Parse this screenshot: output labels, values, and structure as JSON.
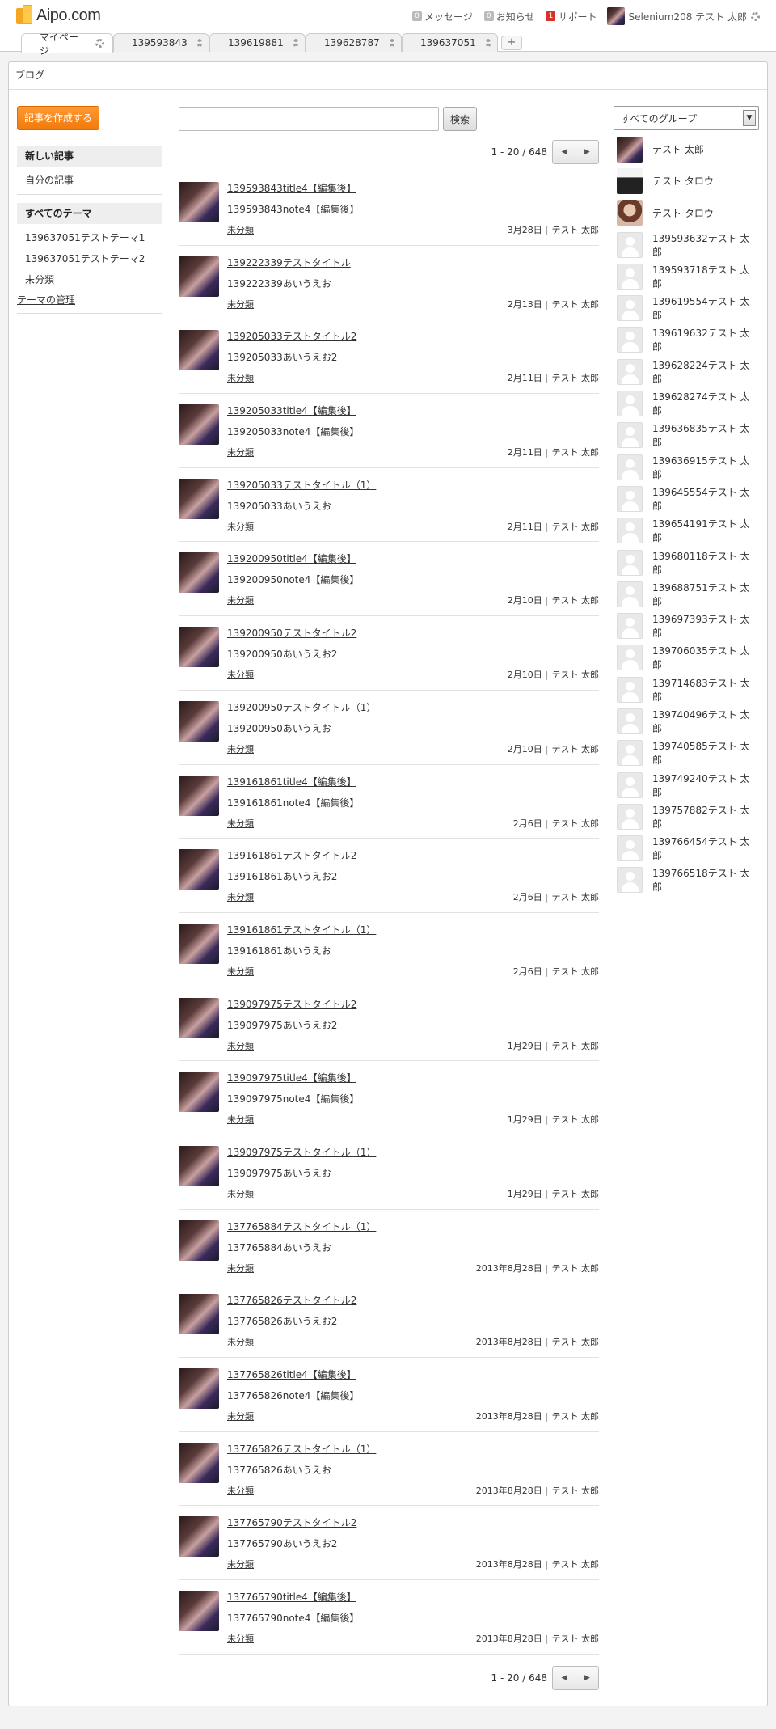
{
  "app": {
    "logo_text": "Aipo.com"
  },
  "header": {
    "messages": {
      "count": "0",
      "label": "メッセージ"
    },
    "notices": {
      "count": "0",
      "label": "お知らせ"
    },
    "support": {
      "count": "1",
      "label": "サポート"
    },
    "user_name": "Selenium208 テスト 太郎"
  },
  "tabs": [
    {
      "label": "マイページ"
    },
    {
      "label": "139593843"
    },
    {
      "label": "139619881"
    },
    {
      "label": "139628787"
    },
    {
      "label": "139637051"
    }
  ],
  "tab_add_label": "+",
  "panel": {
    "title": "ブログ"
  },
  "sidebar": {
    "create_button": "記事を作成する",
    "new_posts": "新しい記事",
    "my_posts": "自分の記事",
    "all_themes": "すべてのテーマ",
    "themes": [
      "139637051テストテーマ1",
      "139637051テストテーマ2",
      "未分類"
    ],
    "manage_themes": "テーマの管理"
  },
  "search": {
    "placeholder": "",
    "value": "",
    "button": "検索"
  },
  "pager": {
    "text": "1 - 20 / 648",
    "prev": "◀",
    "next": "▶"
  },
  "posts": [
    {
      "title": "139593843title4【編集後】",
      "note": "139593843note4【編集後】",
      "theme": "未分類",
      "date": "3月28日",
      "author": "テスト 太郎"
    },
    {
      "title": "139222339テストタイトル",
      "note": "139222339あいうえお",
      "theme": "未分類",
      "date": "2月13日",
      "author": "テスト 太郎"
    },
    {
      "title": "139205033テストタイトル2",
      "note": "139205033あいうえお2",
      "theme": "未分類",
      "date": "2月11日",
      "author": "テスト 太郎"
    },
    {
      "title": "139205033title4【編集後】",
      "note": "139205033note4【編集後】",
      "theme": "未分類",
      "date": "2月11日",
      "author": "テスト 太郎"
    },
    {
      "title": "139205033テストタイトル（1）",
      "note": "139205033あいうえお",
      "theme": "未分類",
      "date": "2月11日",
      "author": "テスト 太郎"
    },
    {
      "title": "139200950title4【編集後】",
      "note": "139200950note4【編集後】",
      "theme": "未分類",
      "date": "2月10日",
      "author": "テスト 太郎"
    },
    {
      "title": "139200950テストタイトル2",
      "note": "139200950あいうえお2",
      "theme": "未分類",
      "date": "2月10日",
      "author": "テスト 太郎"
    },
    {
      "title": "139200950テストタイトル（1）",
      "note": "139200950あいうえお",
      "theme": "未分類",
      "date": "2月10日",
      "author": "テスト 太郎"
    },
    {
      "title": "139161861title4【編集後】",
      "note": "139161861note4【編集後】",
      "theme": "未分類",
      "date": "2月6日",
      "author": "テスト 太郎"
    },
    {
      "title": "139161861テストタイトル2",
      "note": "139161861あいうえお2",
      "theme": "未分類",
      "date": "2月6日",
      "author": "テスト 太郎"
    },
    {
      "title": "139161861テストタイトル（1）",
      "note": "139161861あいうえお",
      "theme": "未分類",
      "date": "2月6日",
      "author": "テスト 太郎"
    },
    {
      "title": "139097975テストタイトル2",
      "note": "139097975あいうえお2",
      "theme": "未分類",
      "date": "1月29日",
      "author": "テスト 太郎"
    },
    {
      "title": "139097975title4【編集後】",
      "note": "139097975note4【編集後】",
      "theme": "未分類",
      "date": "1月29日",
      "author": "テスト 太郎"
    },
    {
      "title": "139097975テストタイトル（1）",
      "note": "139097975あいうえお",
      "theme": "未分類",
      "date": "1月29日",
      "author": "テスト 太郎"
    },
    {
      "title": "137765884テストタイトル（1）",
      "note": "137765884あいうえお",
      "theme": "未分類",
      "date": "2013年8月28日",
      "author": "テスト 太郎"
    },
    {
      "title": "137765826テストタイトル2",
      "note": "137765826あいうえお2",
      "theme": "未分類",
      "date": "2013年8月28日",
      "author": "テスト 太郎"
    },
    {
      "title": "137765826title4【編集後】",
      "note": "137765826note4【編集後】",
      "theme": "未分類",
      "date": "2013年8月28日",
      "author": "テスト 太郎"
    },
    {
      "title": "137765826テストタイトル（1）",
      "note": "137765826あいうえお",
      "theme": "未分類",
      "date": "2013年8月28日",
      "author": "テスト 太郎"
    },
    {
      "title": "137765790テストタイトル2",
      "note": "137765790あいうえお2",
      "theme": "未分類",
      "date": "2013年8月28日",
      "author": "テスト 太郎"
    },
    {
      "title": "137765790title4【編集後】",
      "note": "137765790note4【編集後】",
      "theme": "未分類",
      "date": "2013年8月28日",
      "author": "テスト 太郎"
    }
  ],
  "group_select": {
    "selected": "すべてのグループ",
    "arrow": "▼"
  },
  "members": [
    {
      "name": "テスト 太郎",
      "icon": "photo"
    },
    {
      "name": "テスト タロウ",
      "icon": "suit"
    },
    {
      "name": "テスト タロウ",
      "icon": "girl"
    },
    {
      "name": "139593632テスト 太郎",
      "icon": "blank"
    },
    {
      "name": "139593718テスト 太郎",
      "icon": "blank"
    },
    {
      "name": "139619554テスト 太郎",
      "icon": "blank"
    },
    {
      "name": "139619632テスト 太郎",
      "icon": "blank"
    },
    {
      "name": "139628224テスト 太郎",
      "icon": "blank"
    },
    {
      "name": "139628274テスト 太郎",
      "icon": "blank"
    },
    {
      "name": "139636835テスト 太郎",
      "icon": "blank"
    },
    {
      "name": "139636915テスト 太郎",
      "icon": "blank"
    },
    {
      "name": "139645554テスト 太郎",
      "icon": "blank"
    },
    {
      "name": "139654191テスト 太郎",
      "icon": "blank"
    },
    {
      "name": "139680118テスト 太郎",
      "icon": "blank"
    },
    {
      "name": "139688751テスト 太郎",
      "icon": "blank"
    },
    {
      "name": "139697393テスト 太郎",
      "icon": "blank"
    },
    {
      "name": "139706035テスト 太郎",
      "icon": "blank"
    },
    {
      "name": "139714683テスト 太郎",
      "icon": "blank"
    },
    {
      "name": "139740496テスト 太郎",
      "icon": "blank"
    },
    {
      "name": "139740585テスト 太郎",
      "icon": "blank"
    },
    {
      "name": "139749240テスト 太郎",
      "icon": "blank"
    },
    {
      "name": "139757882テスト 太郎",
      "icon": "blank"
    },
    {
      "name": "139766454テスト 太郎",
      "icon": "blank"
    },
    {
      "name": "139766518テスト 太郎",
      "icon": "blank"
    }
  ]
}
